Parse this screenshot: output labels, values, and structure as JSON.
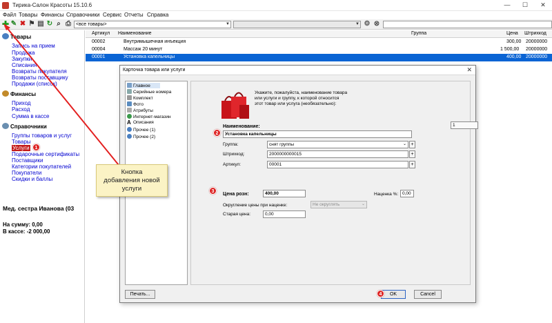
{
  "window": {
    "title": "Тирика-Салон Красоты 15.10.6",
    "min": "—",
    "max": "☐",
    "close": "✕"
  },
  "menu": [
    "Файл",
    "Товары",
    "Финансы",
    "Справочники",
    "Сервис",
    "Отчеты",
    "Справка"
  ],
  "toolbar": {
    "filter_value": "<все товары>",
    "icons": [
      "add-icon",
      "edit-icon",
      "delete-icon",
      "flag-icon",
      "import-icon",
      "refresh-icon",
      "search-icon",
      "print-icon",
      "settings-icon",
      "clear-icon"
    ]
  },
  "sidebar": {
    "sections": [
      {
        "title": "Товары",
        "items": [
          "Запись на прием",
          "Продажа",
          "Закупки",
          "Списания",
          "Возвраты покупателя",
          "Возвраты поставщику",
          "Продажи (список)"
        ]
      },
      {
        "title": "Финансы",
        "items": [
          "Приход",
          "Расход",
          "Сумма в кассе"
        ]
      },
      {
        "title": "Справочники",
        "items": [
          "Группы товаров и услуг",
          "Товары",
          "Услуги",
          "Подарочные сертификаты",
          "Поставщики",
          "Категории покупателей",
          "Покупатели",
          "Скидки и баллы"
        ]
      }
    ],
    "active_item": "Услуги",
    "user": "Мед. сестра Иванова (03",
    "sum_label": "На сумму: 0,00",
    "cash_label": "В кассе: -2 000,00"
  },
  "table": {
    "columns": [
      "Артикул",
      "Наименование",
      "Группа",
      "Цена",
      "Штрихкод"
    ],
    "rows": [
      {
        "article": "00002",
        "name": "Внутримышечная инъекция",
        "group": "",
        "price": "300,00",
        "barcode": "20000000"
      },
      {
        "article": "00004",
        "name": "Массаж 20 минут",
        "group": "",
        "price": "1 500,00",
        "barcode": "20000000"
      },
      {
        "article": "00001",
        "name": "Установка капельницы",
        "group": "",
        "price": "400,00",
        "barcode": "20000000"
      }
    ],
    "selected_index": 2
  },
  "dialog": {
    "title": "Карточка товара или услуги",
    "close": "✕",
    "tree": [
      "Главное",
      "Серийные номера",
      "Комплект",
      "Фото",
      "Атрибуты",
      "Интернет-магазин",
      "Описания",
      "Прочее (1)",
      "Прочее (2)"
    ],
    "tree_selected": 0,
    "hint": [
      "Укажите, пожалуйста, наименование товара",
      "или услуги и группу, к которой относится",
      "этот товар или услуга (необязательно):"
    ],
    "code_value": "1",
    "name_label": "Наименование:",
    "name_value": "Установка капельницы",
    "group_label": "Группа:",
    "group_value": "снят группы",
    "barcode_label": "Штрихкод:",
    "barcode_value": "2000000000015",
    "article_label": "Артикул:",
    "article_value": "00001",
    "price_label": "Цена розн:",
    "price_value": "400,00",
    "markup_label": "Наценка %:",
    "markup_value": "0,00",
    "rounding_label": "Округление цены при наценке:",
    "rounding_value": "Не округлять",
    "old_price_label": "Старая цена:",
    "old_price_value": "0,00",
    "plus": "+",
    "print_button": "Печать...",
    "ok_button": "OK",
    "cancel_button": "Cancel"
  },
  "badges": [
    "1",
    "2",
    "3",
    "4"
  ],
  "callout": {
    "line1": "Кнопка",
    "line2": "добавления новой",
    "line3": "услуги"
  },
  "colors": {
    "accent_red": "#d22222",
    "selection_blue": "#0a64d4",
    "link_blue": "#0000d0",
    "callout_bg": "#fbf3c5"
  }
}
